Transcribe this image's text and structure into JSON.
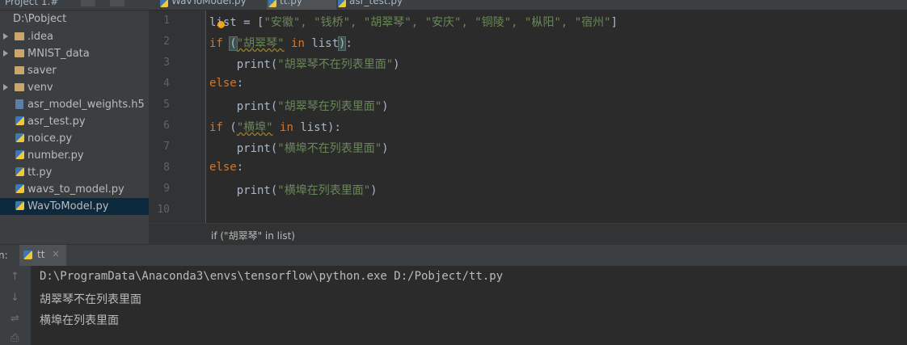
{
  "topbar": {
    "project_label": "Project 1.#",
    "tabs": [
      {
        "label": "WavToModel.py"
      },
      {
        "label": "tt.py"
      },
      {
        "label": "asr_test.py"
      }
    ]
  },
  "sidebar": {
    "items": [
      {
        "label": "D:\\Pobject",
        "kind": "root"
      },
      {
        "label": ".idea",
        "kind": "folder"
      },
      {
        "label": "MNIST_data",
        "kind": "folder"
      },
      {
        "label": "saver",
        "kind": "folder"
      },
      {
        "label": "venv",
        "kind": "folder"
      },
      {
        "label": "asr_model_weights.h5",
        "kind": "file"
      },
      {
        "label": "asr_test.py",
        "kind": "py"
      },
      {
        "label": "noice.py",
        "kind": "py"
      },
      {
        "label": "number.py",
        "kind": "py"
      },
      {
        "label": "tt.py",
        "kind": "py"
      },
      {
        "label": "wavs_to_model.py",
        "kind": "py"
      },
      {
        "label": "WavToModel.py",
        "kind": "py",
        "selected": true
      }
    ]
  },
  "editor": {
    "line_numbers": [
      "1",
      "2",
      "3",
      "4",
      "5",
      "6",
      "7",
      "8",
      "9",
      "10"
    ],
    "lines": {
      "l1": {
        "var": "list",
        "eq": " = [",
        "items": "\"安徽\", \"钱桥\", \"胡翠琴\", \"安庆\", \"铜陵\", \"枞阳\", \"宿州\"",
        "close": "]"
      },
      "l2": {
        "kw": "if",
        "open": "(",
        "str": "\"胡翠琴\"",
        "in": "in",
        "var": "list",
        "close": ")",
        "colon": ":"
      },
      "l3": {
        "fn": "print(",
        "str": "\"胡翠琴不在列表里面\"",
        "close": ")"
      },
      "l4": {
        "kw": "else",
        "colon": ":"
      },
      "l5": {
        "fn": "print(",
        "str": "\"胡翠琴在列表里面\"",
        "close": ")"
      },
      "l6": {
        "kw": "if",
        "open": "(",
        "str": "\"横埠\"",
        "in": "in",
        "var": "list",
        "close": ")",
        "colon": ":"
      },
      "l7": {
        "fn": "print(",
        "str": "\"横埠不在列表里面\"",
        "close": ")"
      },
      "l8": {
        "kw": "else",
        "colon": ":"
      },
      "l9": {
        "fn": "print(",
        "str": "\"横埠在列表里面\"",
        "close": ")"
      }
    }
  },
  "breadcrumb": "if (\"胡翠琴\" in list)",
  "run_panel": {
    "label": "n:",
    "tab_label": "tt",
    "close": "×",
    "tools": [
      "↑",
      "↓",
      "⇌",
      "⎙"
    ],
    "output": [
      "D:\\ProgramData\\Anaconda3\\envs\\tensorflow\\python.exe D:/Pobject/tt.py",
      "胡翠琴不在列表里面",
      "横埠在列表里面"
    ]
  }
}
